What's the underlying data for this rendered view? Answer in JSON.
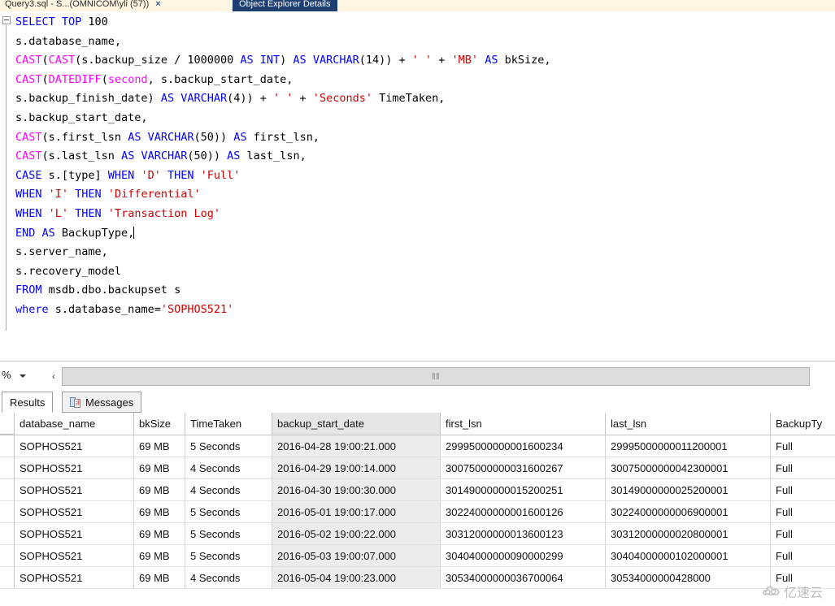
{
  "tabs": {
    "document": {
      "label": "Query3.sql - S...(OMNICOM\\yli (57))",
      "close_icon": "×"
    },
    "object_explorer": {
      "label": "Object Explorer Details"
    }
  },
  "editor": {
    "collapse_icon": "minus-box",
    "lines": [
      [
        {
          "t": "SELECT TOP ",
          "c": "k"
        },
        {
          "t": "100",
          "c": "num"
        }
      ],
      [
        {
          "t": "s.database_name,",
          "c": "n"
        }
      ],
      [
        {
          "t": "CAST",
          "c": "fn"
        },
        {
          "t": "(",
          "c": "n"
        },
        {
          "t": "CAST",
          "c": "fn"
        },
        {
          "t": "(s.backup_size / ",
          "c": "n"
        },
        {
          "t": "1000000",
          "c": "num"
        },
        {
          "t": " AS ",
          "c": "k"
        },
        {
          "t": "INT",
          "c": "k"
        },
        {
          "t": ") ",
          "c": "n"
        },
        {
          "t": "AS ",
          "c": "k"
        },
        {
          "t": "VARCHAR",
          "c": "k"
        },
        {
          "t": "(",
          "c": "n"
        },
        {
          "t": "14",
          "c": "num"
        },
        {
          "t": ")) + ",
          "c": "n"
        },
        {
          "t": "' '",
          "c": "str"
        },
        {
          "t": " + ",
          "c": "n"
        },
        {
          "t": "'MB'",
          "c": "str"
        },
        {
          "t": " AS ",
          "c": "k"
        },
        {
          "t": "bkSize,",
          "c": "n"
        }
      ],
      [
        {
          "t": "CAST",
          "c": "fn"
        },
        {
          "t": "(",
          "c": "n"
        },
        {
          "t": "DATEDIFF",
          "c": "fn"
        },
        {
          "t": "(",
          "c": "n"
        },
        {
          "t": "second",
          "c": "fn"
        },
        {
          "t": ", s.backup_start_date,",
          "c": "n"
        }
      ],
      [
        {
          "t": "s.backup_finish_date) ",
          "c": "n"
        },
        {
          "t": "AS ",
          "c": "k"
        },
        {
          "t": "VARCHAR",
          "c": "k"
        },
        {
          "t": "(",
          "c": "n"
        },
        {
          "t": "4",
          "c": "num"
        },
        {
          "t": ")) + ",
          "c": "n"
        },
        {
          "t": "' '",
          "c": "str"
        },
        {
          "t": " + ",
          "c": "n"
        },
        {
          "t": "'Seconds'",
          "c": "str"
        },
        {
          "t": " TimeTaken,",
          "c": "n"
        }
      ],
      [
        {
          "t": "s.backup_start_date,",
          "c": "n"
        }
      ],
      [
        {
          "t": "CAST",
          "c": "fn"
        },
        {
          "t": "(s.first_lsn ",
          "c": "n"
        },
        {
          "t": "AS ",
          "c": "k"
        },
        {
          "t": "VARCHAR",
          "c": "k"
        },
        {
          "t": "(",
          "c": "n"
        },
        {
          "t": "50",
          "c": "num"
        },
        {
          "t": ")) ",
          "c": "n"
        },
        {
          "t": "AS ",
          "c": "k"
        },
        {
          "t": "first_lsn,",
          "c": "n"
        }
      ],
      [
        {
          "t": "CAST",
          "c": "fn"
        },
        {
          "t": "(s.last_lsn ",
          "c": "n"
        },
        {
          "t": "AS ",
          "c": "k"
        },
        {
          "t": "VARCHAR",
          "c": "k"
        },
        {
          "t": "(",
          "c": "n"
        },
        {
          "t": "50",
          "c": "num"
        },
        {
          "t": ")) ",
          "c": "n"
        },
        {
          "t": "AS ",
          "c": "k"
        },
        {
          "t": "last_lsn,",
          "c": "n"
        }
      ],
      [
        {
          "t": "CASE ",
          "c": "k"
        },
        {
          "t": "s.[type] ",
          "c": "n"
        },
        {
          "t": "WHEN ",
          "c": "k"
        },
        {
          "t": "'D'",
          "c": "str"
        },
        {
          "t": " ",
          "c": "n"
        },
        {
          "t": "THEN ",
          "c": "k"
        },
        {
          "t": "'Full'",
          "c": "str"
        }
      ],
      [
        {
          "t": "WHEN ",
          "c": "k"
        },
        {
          "t": "'I'",
          "c": "str"
        },
        {
          "t": " ",
          "c": "n"
        },
        {
          "t": "THEN ",
          "c": "k"
        },
        {
          "t": "'Differential'",
          "c": "str"
        }
      ],
      [
        {
          "t": "WHEN ",
          "c": "k"
        },
        {
          "t": "'L'",
          "c": "str"
        },
        {
          "t": " ",
          "c": "n"
        },
        {
          "t": "THEN ",
          "c": "k"
        },
        {
          "t": "'Transaction Log'",
          "c": "str"
        }
      ],
      [
        {
          "t": "END AS ",
          "c": "k"
        },
        {
          "t": "BackupType,",
          "c": "n"
        },
        {
          "t": "|CARET|",
          "c": "caret"
        }
      ],
      [
        {
          "t": "s.server_name,",
          "c": "n"
        }
      ],
      [
        {
          "t": "s.recovery_model",
          "c": "n"
        }
      ],
      [
        {
          "t": "FROM ",
          "c": "k"
        },
        {
          "t": "msdb.dbo.backupset s",
          "c": "n"
        }
      ],
      [
        {
          "t": "where ",
          "c": "k"
        },
        {
          "t": "s.database_name=",
          "c": "n"
        },
        {
          "t": "'SOPHOS521'",
          "c": "str"
        }
      ]
    ]
  },
  "splitbar": {
    "zoom_label": "%",
    "dropdown_icon": "chevron-down-icon",
    "scroll_left_icon": "‹",
    "grip_icon": "‖‖"
  },
  "results_pane": {
    "tabs": [
      {
        "label": "Results",
        "active": true
      },
      {
        "label": "Messages",
        "active": false,
        "icon": "messages-icon"
      }
    ]
  },
  "grid": {
    "columns": [
      {
        "key": "database_name",
        "label": "database_name",
        "cls": "c-db"
      },
      {
        "key": "bkSize",
        "label": "bkSize",
        "cls": "c-sz"
      },
      {
        "key": "TimeTaken",
        "label": "TimeTaken",
        "cls": "c-tt"
      },
      {
        "key": "backup_start_date",
        "label": "backup_start_date",
        "cls": "c-bsd",
        "selected": true
      },
      {
        "key": "first_lsn",
        "label": "first_lsn",
        "cls": "c-fl"
      },
      {
        "key": "last_lsn",
        "label": "last_lsn",
        "cls": "c-ll"
      },
      {
        "key": "BackupType",
        "label": "BackupTy",
        "cls": "c-bt"
      }
    ],
    "rows": [
      [
        "SOPHOS521",
        "69 MB",
        "5 Seconds",
        "2016-04-28 19:00:21.000",
        "29995000000001600234",
        "29995000000011200001",
        "Full"
      ],
      [
        "SOPHOS521",
        "69 MB",
        "4 Seconds",
        "2016-04-29 19:00:14.000",
        "30075000000031600267",
        "30075000000042300001",
        "Full"
      ],
      [
        "SOPHOS521",
        "69 MB",
        "4 Seconds",
        "2016-04-30 19:00:30.000",
        "30149000000015200251",
        "30149000000025200001",
        "Full"
      ],
      [
        "SOPHOS521",
        "69 MB",
        "5 Seconds",
        "2016-05-01 19:00:17.000",
        "30224000000001600126",
        "30224000000006900001",
        "Full"
      ],
      [
        "SOPHOS521",
        "69 MB",
        "5 Seconds",
        "2016-05-02 19:00:22.000",
        "30312000000013600123",
        "30312000000020800001",
        "Full"
      ],
      [
        "SOPHOS521",
        "69 MB",
        "5 Seconds",
        "2016-05-03 19:00:07.000",
        "30404000000090000299",
        "30404000000102000001",
        "Full"
      ],
      [
        "SOPHOS521",
        "69 MB",
        "4 Seconds",
        "2016-05-04 19:00:23.000",
        "30534000000036700064",
        "30534000000428000",
        "Full"
      ]
    ]
  },
  "watermark": {
    "icon": "cloud-icon",
    "text": "亿速云"
  }
}
